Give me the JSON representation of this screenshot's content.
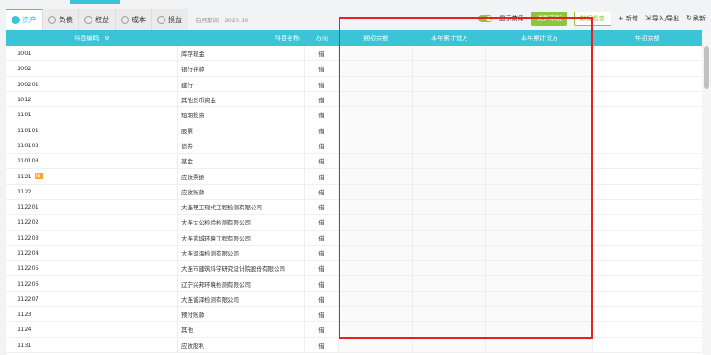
{
  "tabs": [
    {
      "label": "资产",
      "icon": "asset-icon",
      "active": true
    },
    {
      "label": "负债",
      "icon": "liability-icon"
    },
    {
      "label": "权益",
      "icon": "equity-icon"
    },
    {
      "label": "成本",
      "icon": "cost-icon"
    },
    {
      "label": "损益",
      "icon": "profit-loss-icon"
    }
  ],
  "enable_date": "启用期间：2020.10",
  "toolbar": {
    "show_disabled": "显示禁用",
    "trial_balance": "试算平衡",
    "data_check": "数据检查",
    "add": "+ 新增",
    "import_export": "导入/导出",
    "refresh": "刷新"
  },
  "headers": [
    "科目编码",
    "科目名称",
    "方向",
    "期初余额",
    "本年累计借方",
    "本年累计贷方",
    "年初余额"
  ],
  "rows": [
    [
      "1001",
      "库存现金",
      "借"
    ],
    [
      "1002",
      "银行存款",
      "借"
    ],
    [
      "100201",
      "建行",
      "借"
    ],
    [
      "1012",
      "其他货币资金",
      "借"
    ],
    [
      "1101",
      "短期投资",
      "借"
    ],
    [
      "110101",
      "股票",
      "借"
    ],
    [
      "110102",
      "债券",
      "借"
    ],
    [
      "110103",
      "基金",
      "借"
    ],
    [
      "1121",
      "应收票据",
      "借",
      "辅"
    ],
    [
      "1122",
      "应收账款",
      "借"
    ],
    [
      "112201",
      "大连理工现代工程检测有限公司",
      "借"
    ],
    [
      "112202",
      "大连大公检验检测有限公司",
      "借"
    ],
    [
      "112203",
      "大连蓝城环境工程有限公司",
      "借"
    ],
    [
      "112204",
      "大连润海检测有限公司",
      "借"
    ],
    [
      "112205",
      "大连市建筑科学研究设计院股份有限公司",
      "借"
    ],
    [
      "112206",
      "辽宁兴邦环境检测有限公司",
      "借"
    ],
    [
      "112207",
      "大连诚泽检测有限公司",
      "借"
    ],
    [
      "1123",
      "预付账款",
      "借"
    ],
    [
      "1124",
      "其他",
      "借"
    ],
    [
      "1131",
      "应收股利",
      "借"
    ]
  ],
  "colors": {
    "accent": "#3bc4d8",
    "green": "#8cc63f",
    "highlight": "#e82020"
  }
}
